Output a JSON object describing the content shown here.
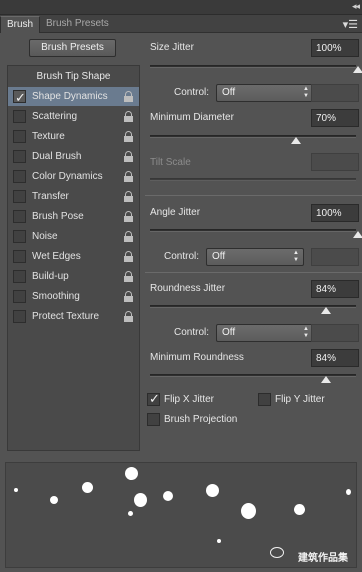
{
  "window": {
    "collapse_icon": "collapse-arrows"
  },
  "tabs": [
    {
      "label": "Brush",
      "active": true
    },
    {
      "label": "Brush Presets",
      "active": false
    }
  ],
  "panel_menu_icon": "panel-menu-icon",
  "brush_presets_button": "Brush Presets",
  "sidebar": {
    "heading": "Brush Tip Shape",
    "items": [
      {
        "label": "Shape Dynamics",
        "checked": true,
        "selected": true
      },
      {
        "label": "Scattering",
        "checked": false
      },
      {
        "label": "Texture",
        "checked": false
      },
      {
        "label": "Dual Brush",
        "checked": false
      },
      {
        "label": "Color Dynamics",
        "checked": false
      },
      {
        "label": "Transfer",
        "checked": false
      },
      {
        "label": "Brush Pose",
        "checked": false
      },
      {
        "label": "Noise",
        "checked": false
      },
      {
        "label": "Wet Edges",
        "checked": false
      },
      {
        "label": "Build-up",
        "checked": false
      },
      {
        "label": "Smoothing",
        "checked": false
      },
      {
        "label": "Protect Texture",
        "checked": false
      }
    ]
  },
  "settings": {
    "size_jitter": {
      "label": "Size Jitter",
      "value": "100%",
      "level": 1.0
    },
    "size_control": {
      "label": "Control:",
      "value": "Off"
    },
    "minimum_diameter": {
      "label": "Minimum Diameter",
      "value": "70%",
      "level": 0.7
    },
    "tilt_scale": {
      "label": "Tilt Scale",
      "value": ""
    },
    "angle_jitter": {
      "label": "Angle Jitter",
      "value": "100%",
      "level": 1.0
    },
    "angle_control": {
      "label": "Control:",
      "value": "Off"
    },
    "roundness_jitter": {
      "label": "Roundness Jitter",
      "value": "84%",
      "level": 0.84
    },
    "roundness_control": {
      "label": "Control:",
      "value": "Off"
    },
    "minimum_roundness": {
      "label": "Minimum Roundness",
      "value": "84%",
      "level": 0.84
    },
    "flip_x": {
      "label": "Flip X Jitter",
      "checked": true
    },
    "flip_y": {
      "label": "Flip Y Jitter",
      "checked": false
    },
    "brush_projection": {
      "label": "Brush Projection",
      "checked": false
    }
  },
  "preview": {
    "watermark": "建筑作品集"
  },
  "colors": {
    "panel": "#535353",
    "selection": "#6a7b8f"
  }
}
